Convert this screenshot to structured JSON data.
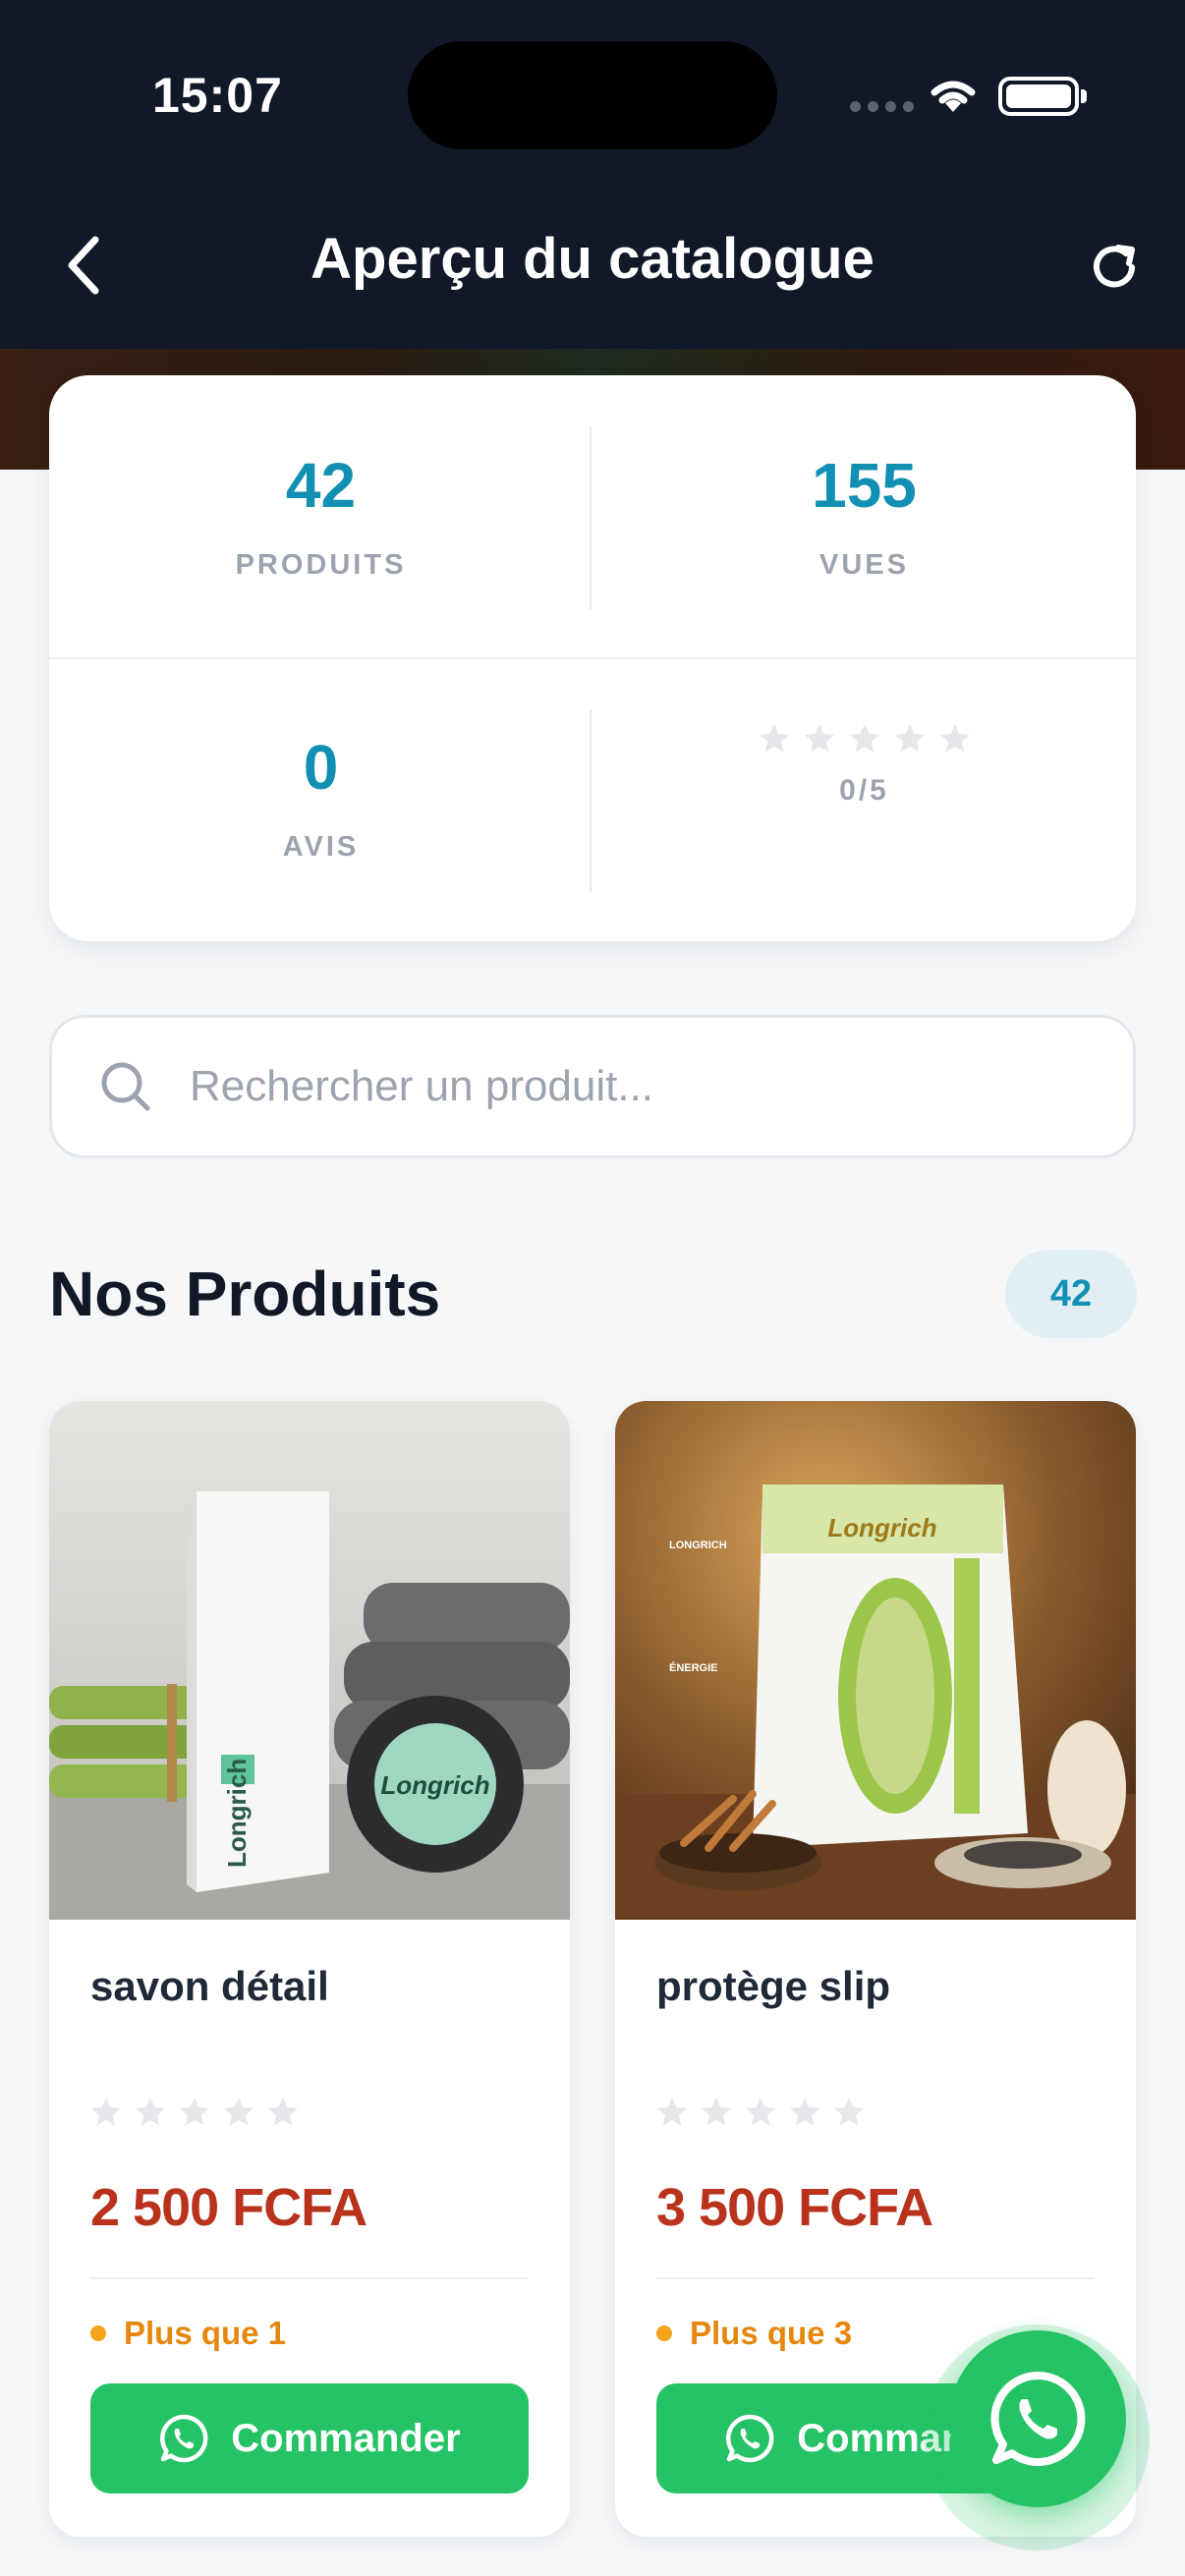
{
  "status_bar": {
    "time": "15:07"
  },
  "header": {
    "title": "Aperçu du catalogue"
  },
  "stats": {
    "products": {
      "value": "42",
      "label": "PRODUITS"
    },
    "views": {
      "value": "155",
      "label": "VUES"
    },
    "reviews": {
      "value": "0",
      "label": "AVIS"
    },
    "rating": {
      "stars_filled": 0,
      "stars_total": 5,
      "text": "0/5"
    }
  },
  "search": {
    "placeholder": "Rechercher un produit..."
  },
  "section": {
    "title": "Nos Produits",
    "count": "42"
  },
  "products": [
    {
      "name": "savon détail",
      "stars_filled": 0,
      "price": "2 500 FCFA",
      "stock": "Plus que 1",
      "button_label": "Commander",
      "image_brand": "Longrich"
    },
    {
      "name": "protège slip",
      "stars_filled": 0,
      "price": "3 500 FCFA",
      "stock": "Plus que 3",
      "button_label": "Commander",
      "image_brand": "Longrich"
    }
  ],
  "icons": {
    "back": "chevron-left-icon",
    "refresh": "refresh-icon",
    "search": "search-icon",
    "star": "star-icon",
    "whatsapp": "whatsapp-icon"
  },
  "colors": {
    "header_bg": "#111827",
    "accent": "#1190b4",
    "price": "#b8321c",
    "stock": "#e6870c",
    "whatsapp_green": "#25c366",
    "star_empty": "#e5e7eb"
  }
}
